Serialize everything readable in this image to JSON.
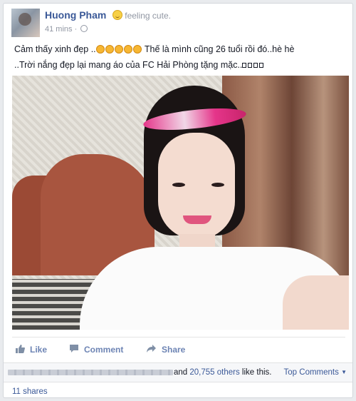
{
  "post": {
    "author": "Huong Pham",
    "feeling": "feeling cute.",
    "timestamp": "41 mins",
    "separator": " · ",
    "text_line1_part1": "Cảm thấy xinh đẹp ..",
    "text_line1_part2": " Thế là mình cũng 26 tuổi rồi đó..hè hè",
    "text_line2": "..Trời nắng đẹp lại mang áo của FC Hải Phòng tặng mặc..",
    "inline_emoji_count": 5,
    "trailing_symbol_count": 4
  },
  "actions": {
    "like_label": "Like",
    "comment_label": "Comment",
    "share_label": "Share"
  },
  "likes": {
    "prefix": "and ",
    "count_text": "20,755 others",
    "suffix": " like this."
  },
  "comments": {
    "sort_label": "Top Comments"
  },
  "shares": {
    "label": "11 shares"
  },
  "colors": {
    "link": "#3b5998",
    "action": "#6d84b4",
    "muted": "#9197a3"
  }
}
